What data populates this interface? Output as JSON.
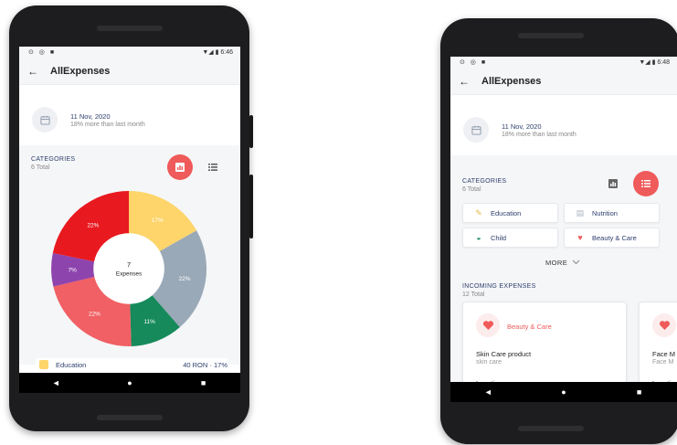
{
  "phone1": {
    "status": {
      "left_icons": "⊙ ◎ ■",
      "right": "▼◢ ▮ 6:46"
    },
    "appbar": {
      "back_icon": "←",
      "title": "AllExpenses"
    },
    "date": {
      "line1": "11 Nov, 2020",
      "line2": "18% more than last month"
    },
    "categories": {
      "title": "CATEGORIES",
      "subtitle": "6 Total"
    },
    "donut_center": {
      "count": "7",
      "label": "Expenses"
    },
    "legend_first": {
      "label": "Education",
      "value": "40 RON · 17%",
      "color": "#fdd56a"
    },
    "nav": {
      "back": "◄",
      "home": "●",
      "recent": "■"
    }
  },
  "chart_data": {
    "type": "pie",
    "title": "",
    "center_text": "7 Expenses",
    "slices": [
      {
        "label": "17%",
        "value": 17,
        "color": "#fdd56a"
      },
      {
        "label": "22%",
        "value": 22,
        "color": "#9aa9b8"
      },
      {
        "label": "11%",
        "value": 11,
        "color": "#168a5a"
      },
      {
        "label": "22%",
        "value": 22,
        "color": "#f06064"
      },
      {
        "label": "7%",
        "value": 7,
        "color": "#8e44ad"
      },
      {
        "label": "22%",
        "value": 22,
        "color": "#e8191f"
      }
    ]
  },
  "phone2": {
    "status": {
      "left_icons": "⊙ ◎ ■",
      "right": "▼◢ ▮ 6:48"
    },
    "appbar": {
      "back_icon": "←",
      "title": "AllExpenses"
    },
    "date": {
      "line1": "11 Nov, 2020",
      "line2": "18% more than last month"
    },
    "categories": {
      "title": "CATEGORIES",
      "subtitle": "6 Total"
    },
    "chips": [
      {
        "label": "Education",
        "icon": "✎",
        "color": "#e8b94a"
      },
      {
        "label": "Nutrition",
        "icon": "▤",
        "color": "#aab4c0"
      },
      {
        "label": "Child",
        "icon": "◒",
        "color": "#168a5a"
      },
      {
        "label": "Beauty & Care",
        "icon": "♥",
        "color": "#ef5a5a"
      }
    ],
    "more": "MORE",
    "incoming": {
      "title": "INCOMING EXPENSES",
      "subtitle": "12 Total"
    },
    "card1": {
      "category": "Beauty & Care",
      "name": "Skin Care product",
      "desc": "skin care",
      "location": "Location"
    },
    "card2": {
      "name": "Face M",
      "desc": "Face M",
      "location": "Locati"
    },
    "nav": {
      "back": "◄",
      "home": "●",
      "recent": "■"
    }
  }
}
